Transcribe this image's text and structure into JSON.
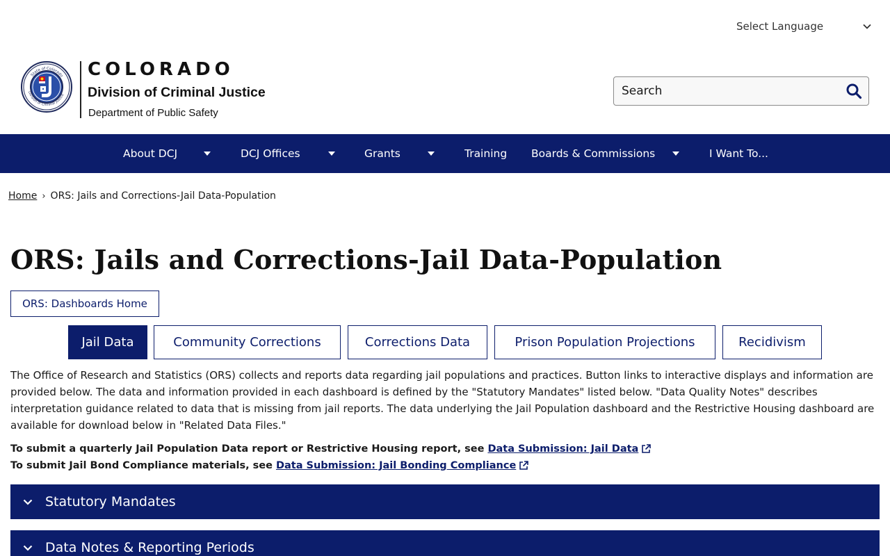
{
  "language": {
    "label": "Select Language",
    "icon": "chevron-down-icon"
  },
  "branding": {
    "state": "COLORADO",
    "division": "Division of Criminal Justice",
    "department": "Department of Public Safety",
    "seal_text": "State of Colorado · Division of Criminal Justice"
  },
  "search": {
    "placeholder": "Search",
    "icon": "search-icon"
  },
  "nav": {
    "items": [
      {
        "label": "About DCJ",
        "has_dropdown": true
      },
      {
        "label": "DCJ Offices",
        "has_dropdown": true
      },
      {
        "label": "Grants",
        "has_dropdown": true
      },
      {
        "label": "Training",
        "has_dropdown": false
      },
      {
        "label": "Boards & Commissions",
        "has_dropdown": true
      },
      {
        "label": "I Want To...",
        "has_dropdown": false
      }
    ]
  },
  "breadcrumb": {
    "home": "Home",
    "separator": "›",
    "current": "ORS: Jails and Corrections-Jail Data-Population"
  },
  "page": {
    "title": "ORS: Jails and Corrections-Jail Data-Population",
    "home_button": "ORS: Dashboards Home",
    "tabs": [
      {
        "label": "Jail Data",
        "active": true
      },
      {
        "label": "Community Corrections",
        "active": false
      },
      {
        "label": "Corrections Data",
        "active": false
      },
      {
        "label": "Prison Population Projections",
        "active": false
      },
      {
        "label": "Recidivism",
        "active": false
      }
    ],
    "intro": "The Office of Research and Statistics (ORS) collects and reports data regarding jail populations and practices. Button links to interactive displays and information are provided below. The data and information provided in each dashboard is defined by the \"Statutory Mandates\" listed below. \"Data Quality Notes\" describes interpretation guidance related to data that is missing from jail reports. The data underlying the Jail Population dashboard and the Restrictive Housing dashboard are available for download below in \"Related Data Files.\"",
    "submit_lines": [
      {
        "text": "To submit a quarterly Jail Population Data report or Restrictive Housing report, see",
        "link": "Data Submission: Jail Data"
      },
      {
        "text": "To submit Jail Bond Compliance materials, see",
        "link": "Data Submission: Jail Bonding Compliance"
      }
    ],
    "accordions": [
      {
        "title": "Statutory Mandates",
        "expanded": false
      },
      {
        "title": "Data Notes & Reporting Periods",
        "expanded": false
      }
    ]
  },
  "colors": {
    "brand_navy": "#0c1d6b",
    "text": "#1a1a1a",
    "background": "#ffffff"
  }
}
